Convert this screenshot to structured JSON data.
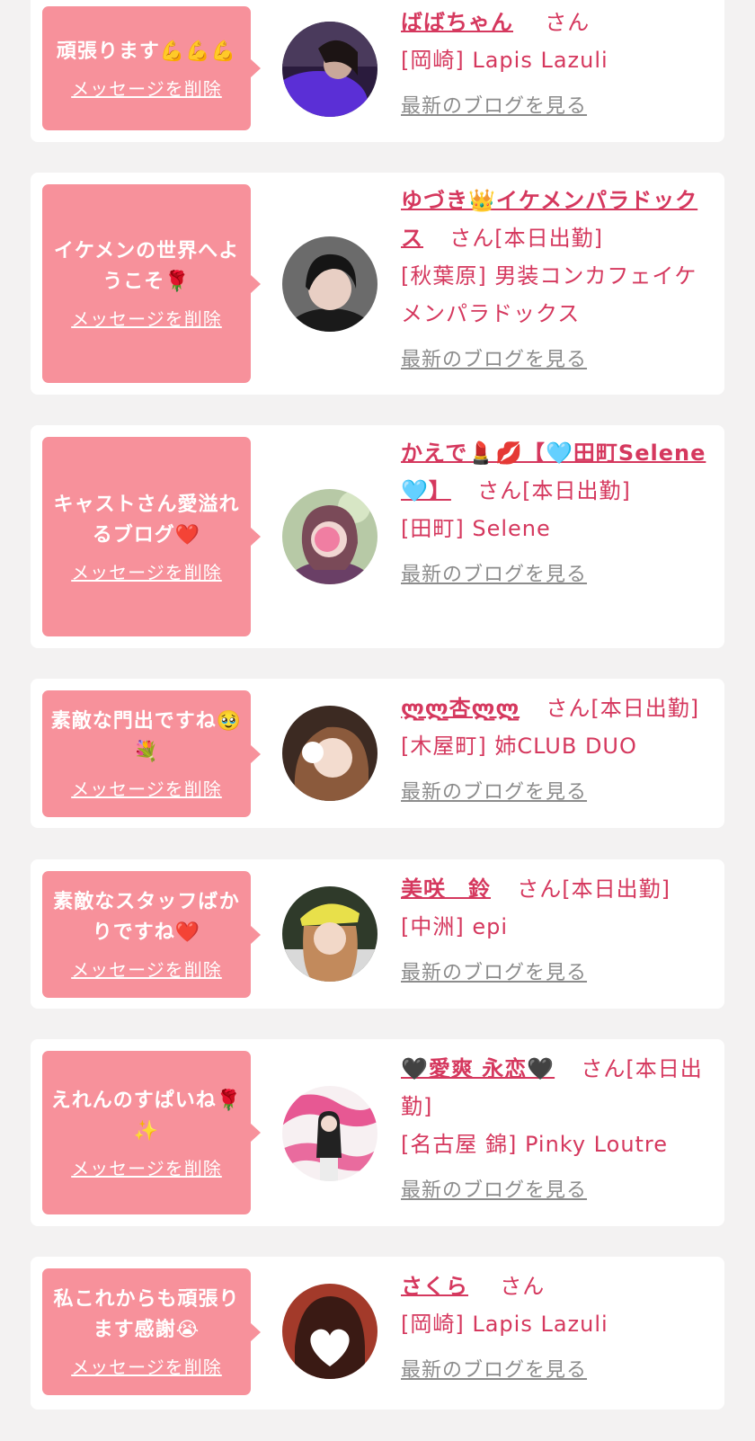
{
  "cards": [
    {
      "message": "頑張ります💪💪💪",
      "delete_label": "メッセージを削除",
      "name": "ばばちゃん",
      "suffix": "さん",
      "shop": "[岡崎] Lapis Lazuli",
      "blog_label": "最新のブログを見る"
    },
    {
      "message": "イケメンの世界へようこそ🌹",
      "delete_label": "メッセージを削除",
      "name": "ゆづき👑イケメンパラドックス",
      "suffix": "さん[本日出勤]",
      "shop": "[秋葉原] 男装コンカフェイケメンパラドックス",
      "blog_label": "最新のブログを見る"
    },
    {
      "message": "キャストさん愛溢れるブログ❤️",
      "delete_label": "メッセージを削除",
      "name": "かえで💄💋【🩵田町Selene🩵】",
      "suffix": "さん[本日出勤]",
      "shop": "[田町] Selene",
      "blog_label": "最新のブログを見る"
    },
    {
      "message": "素敵な門出ですね🥹💐",
      "delete_label": "メッセージを削除",
      "name": "ლ̲ლ̲杏ლ̲ლ̲",
      "suffix": "さん[本日出勤]",
      "shop": "[木屋町] 姉CLUB DUO",
      "blog_label": "最新のブログを見る"
    },
    {
      "message": "素敵なスタッフばかりですね❤️",
      "delete_label": "メッセージを削除",
      "name": "美咲　鈴",
      "suffix": "さん[本日出勤]",
      "shop": "[中洲] epi",
      "blog_label": "最新のブログを見る"
    },
    {
      "message": "えれんのすぱいね🌹✨",
      "delete_label": "メッセージを削除",
      "name": "🖤愛爽 永恋🖤",
      "suffix": "さん[本日出勤]",
      "shop": "[名古屋 錦] Pinky Loutre",
      "blog_label": "最新のブログを見る"
    },
    {
      "message": "私これからも頑張ります感謝😭",
      "delete_label": "メッセージを削除",
      "name": "さくら",
      "suffix": "さん",
      "shop": "[岡崎] Lapis Lazuli",
      "blog_label": "最新のブログを見る"
    }
  ],
  "colors": {
    "accent": "#d5385e",
    "bubble": "#f7919b",
    "link_gray": "#8c8c8c",
    "background": "#f3f2f2"
  }
}
